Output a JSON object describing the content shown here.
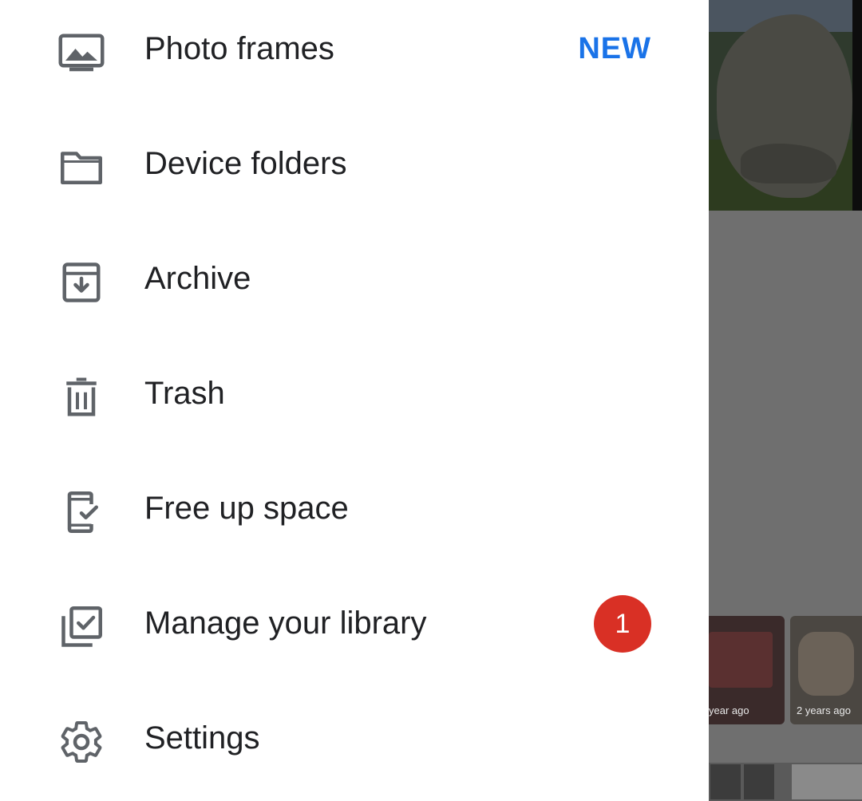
{
  "drawer": {
    "items": [
      {
        "label": "Photo frames",
        "icon": "photo-frame-icon",
        "tag": "NEW"
      },
      {
        "label": "Device folders",
        "icon": "folder-icon"
      },
      {
        "label": "Archive",
        "icon": "archive-icon"
      },
      {
        "label": "Trash",
        "icon": "trash-icon"
      },
      {
        "label": "Free up space",
        "icon": "free-up-space-icon"
      },
      {
        "label": "Manage your library",
        "icon": "manage-library-icon",
        "badge": "1"
      },
      {
        "label": "Settings",
        "icon": "settings-icon"
      }
    ]
  },
  "background": {
    "tiles": [
      {
        "label": "year ago"
      },
      {
        "label": "2 years ago"
      }
    ]
  },
  "colors": {
    "accent": "#1a73e8",
    "badge": "#d93025",
    "icon": "#5f6368",
    "text": "#202124",
    "scrim": "#6f6f6f"
  }
}
